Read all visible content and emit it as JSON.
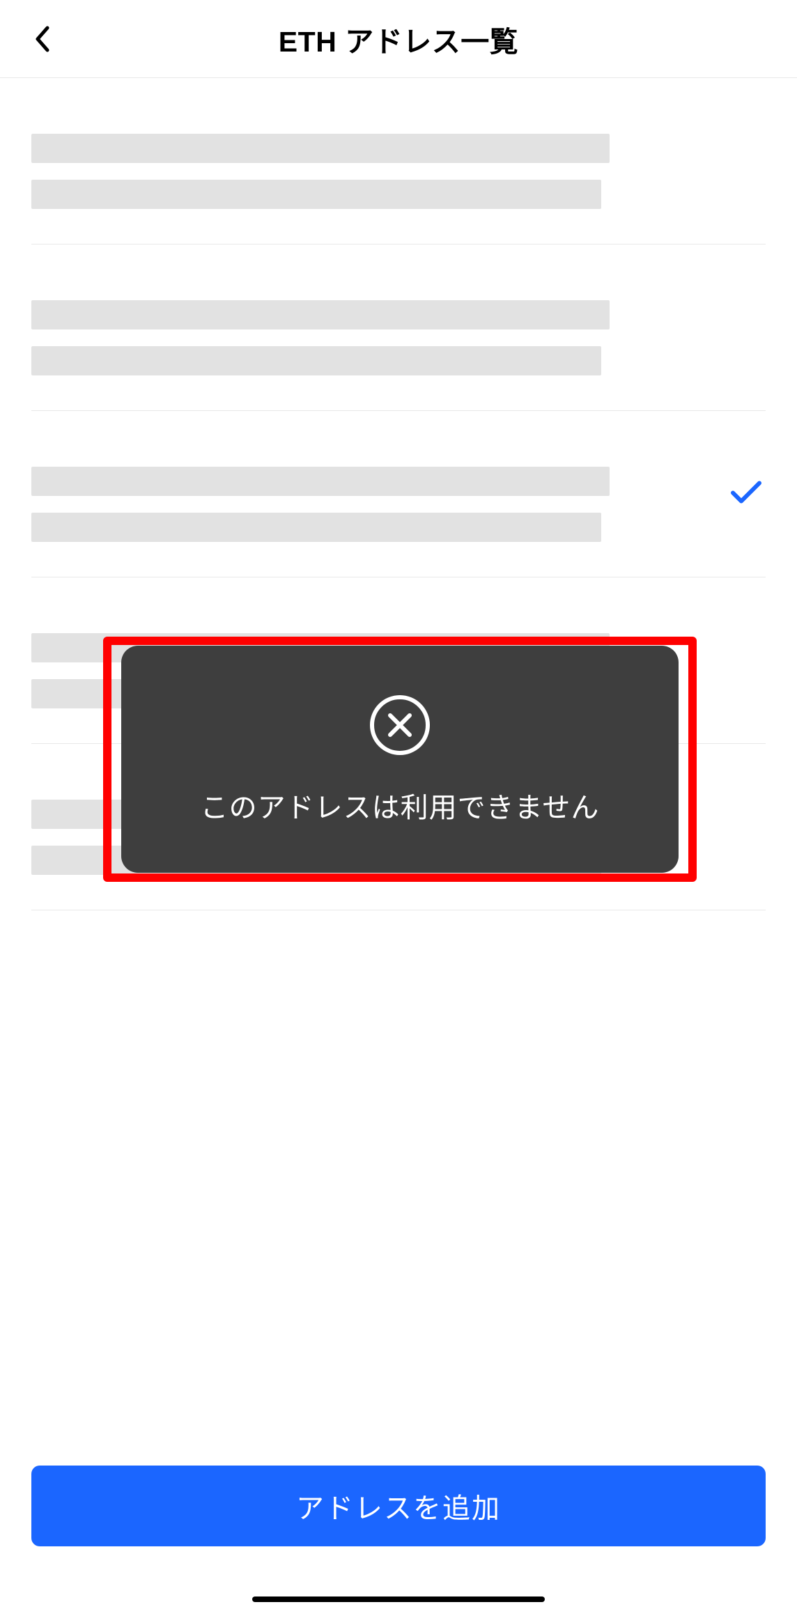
{
  "header": {
    "title": "ETH アドレス一覧"
  },
  "list": {
    "items": [
      {
        "selected": false
      },
      {
        "selected": false
      },
      {
        "selected": true
      },
      {
        "selected": false
      },
      {
        "selected": false
      }
    ]
  },
  "toast": {
    "message": "このアドレスは利用できません"
  },
  "buttons": {
    "add_label": "アドレスを追加"
  },
  "colors": {
    "primary": "#1b66ff",
    "toast_bg": "#3e3e3e",
    "highlight_border": "#ff0000",
    "skeleton": "#e2e2e2",
    "check": "#1b66ff"
  }
}
